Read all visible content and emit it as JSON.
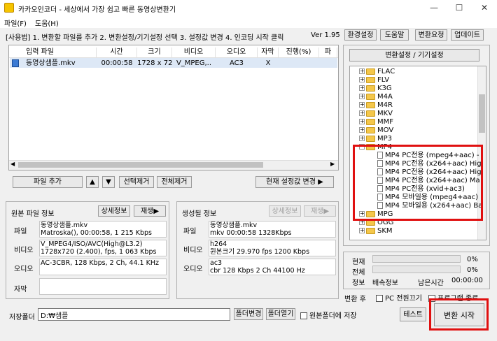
{
  "window": {
    "title": "카카오인코더 - 세상에서 가장 쉽고 빠른 동영상변환기",
    "minimize": "—",
    "maximize": "☐",
    "close": "✕"
  },
  "menu": {
    "file": "파일(F)",
    "help": "도움(H)"
  },
  "instructions": "[사용법] 1. 변환할 파일를 추가  2. 변환설정/기기설정 선택  3. 설정값 변경  4. 인코딩 시작 클릭",
  "version": "Ver 1.95",
  "top_buttons": {
    "env": "환경설정",
    "help": "도움말",
    "request": "변환요청",
    "update": "업데이트"
  },
  "file_list": {
    "columns": [
      "입력 파일",
      "시간",
      "크기",
      "비디오",
      "오디오",
      "자막",
      "진행(%)",
      "파"
    ],
    "rows": [
      {
        "file": "동영상샘플.mkv",
        "time": "00:00:58",
        "size": "1728 x 720",
        "video": "V_MPEG,..",
        "audio": "AC3",
        "subtitle": "X",
        "progress": ""
      }
    ]
  },
  "list_buttons": {
    "add": "파일 추가",
    "up": "▲",
    "down": "▼",
    "remove_sel": "선택제거",
    "remove_all": "전체제거",
    "apply_setting": "현재 설정값 변경 ▶"
  },
  "source_info": {
    "title": "원본 파일 정보",
    "detail_btn": "상세정보",
    "play_btn": "재생▶",
    "file_label": "파일",
    "file_lines": [
      "동영상샘플.mkv",
      "Matroska(), 00:00:58, 1 215 Kbps"
    ],
    "video_label": "비디오",
    "video_lines": [
      "V_MPEG4/ISO/AVC(High@L3.2)",
      "1728x720 (2.400),  fps, 1 063 Kbps"
    ],
    "audio_label": "오디오",
    "audio_lines": [
      "AC-3CBR, 128 Kbps, 2 Ch, 44.1 KHz"
    ],
    "sub_label": "자막"
  },
  "output_info": {
    "title": "생성될 정보",
    "detail_btn": "상세정보",
    "play_btn": "재생▶",
    "file_label": "파일",
    "file_lines": [
      "동영상샘플.mkv",
      "mkv  00:00:58  1328Kbps"
    ],
    "video_label": "비디오",
    "video_lines": [
      "h264",
      "원본크기  29.970 fps  1200 Kbps"
    ],
    "audio_label": "오디오",
    "audio_lines": [
      "ac3",
      "cbr    128 Kbps  2 Ch   44100 Hz"
    ]
  },
  "settings_button": "변환설정 / 기기설정",
  "tree": {
    "folders_before": [
      "FLAC",
      "FLV",
      "K3G",
      "M4A",
      "M4R",
      "MKV",
      "MMF",
      "MOV",
      "MP3"
    ],
    "open_folder": "MP4",
    "mp4_items": [
      "MP4 PC전용 (mpeg4+aac) -",
      "MP4 PC전용 (x264+aac) Hig",
      "MP4 PC전용 (x264+aac) Hig",
      "MP4 PC전용 (x264+aac) Ma",
      "MP4 PC전용 (xvid+ac3)",
      "MP4 모바일용 (mpeg4+aac)",
      "MP4 모바일용 (x264+aac) Ba"
    ],
    "folders_after": [
      "MPG",
      "OGG",
      "SKM"
    ]
  },
  "progress": {
    "current_label": "현재",
    "current_value": "0%",
    "current_fraction": 0,
    "total_label": "전체",
    "total_value": "0%",
    "total_fraction": 0,
    "info_label": "정보",
    "speed_label": "배속정보",
    "remain_label": "남은시간",
    "remain_value": "00:00:00"
  },
  "after_convert": {
    "label": "변환 후",
    "pc_off": "PC 전원끄기",
    "exit_program": "프로그램 종료"
  },
  "bottom": {
    "save_label": "저장폴더",
    "save_path": "D:₩샘플",
    "change_folder": "폴더변경",
    "open_folder": "폴더열기",
    "save_to_source": "원본폴더에 저장",
    "test": "테스트",
    "start": "변환 시작"
  },
  "colors": {
    "highlight_red": "#e01010",
    "folder_yellow": "#f4c74b",
    "selected_row": "#dde8f6"
  }
}
